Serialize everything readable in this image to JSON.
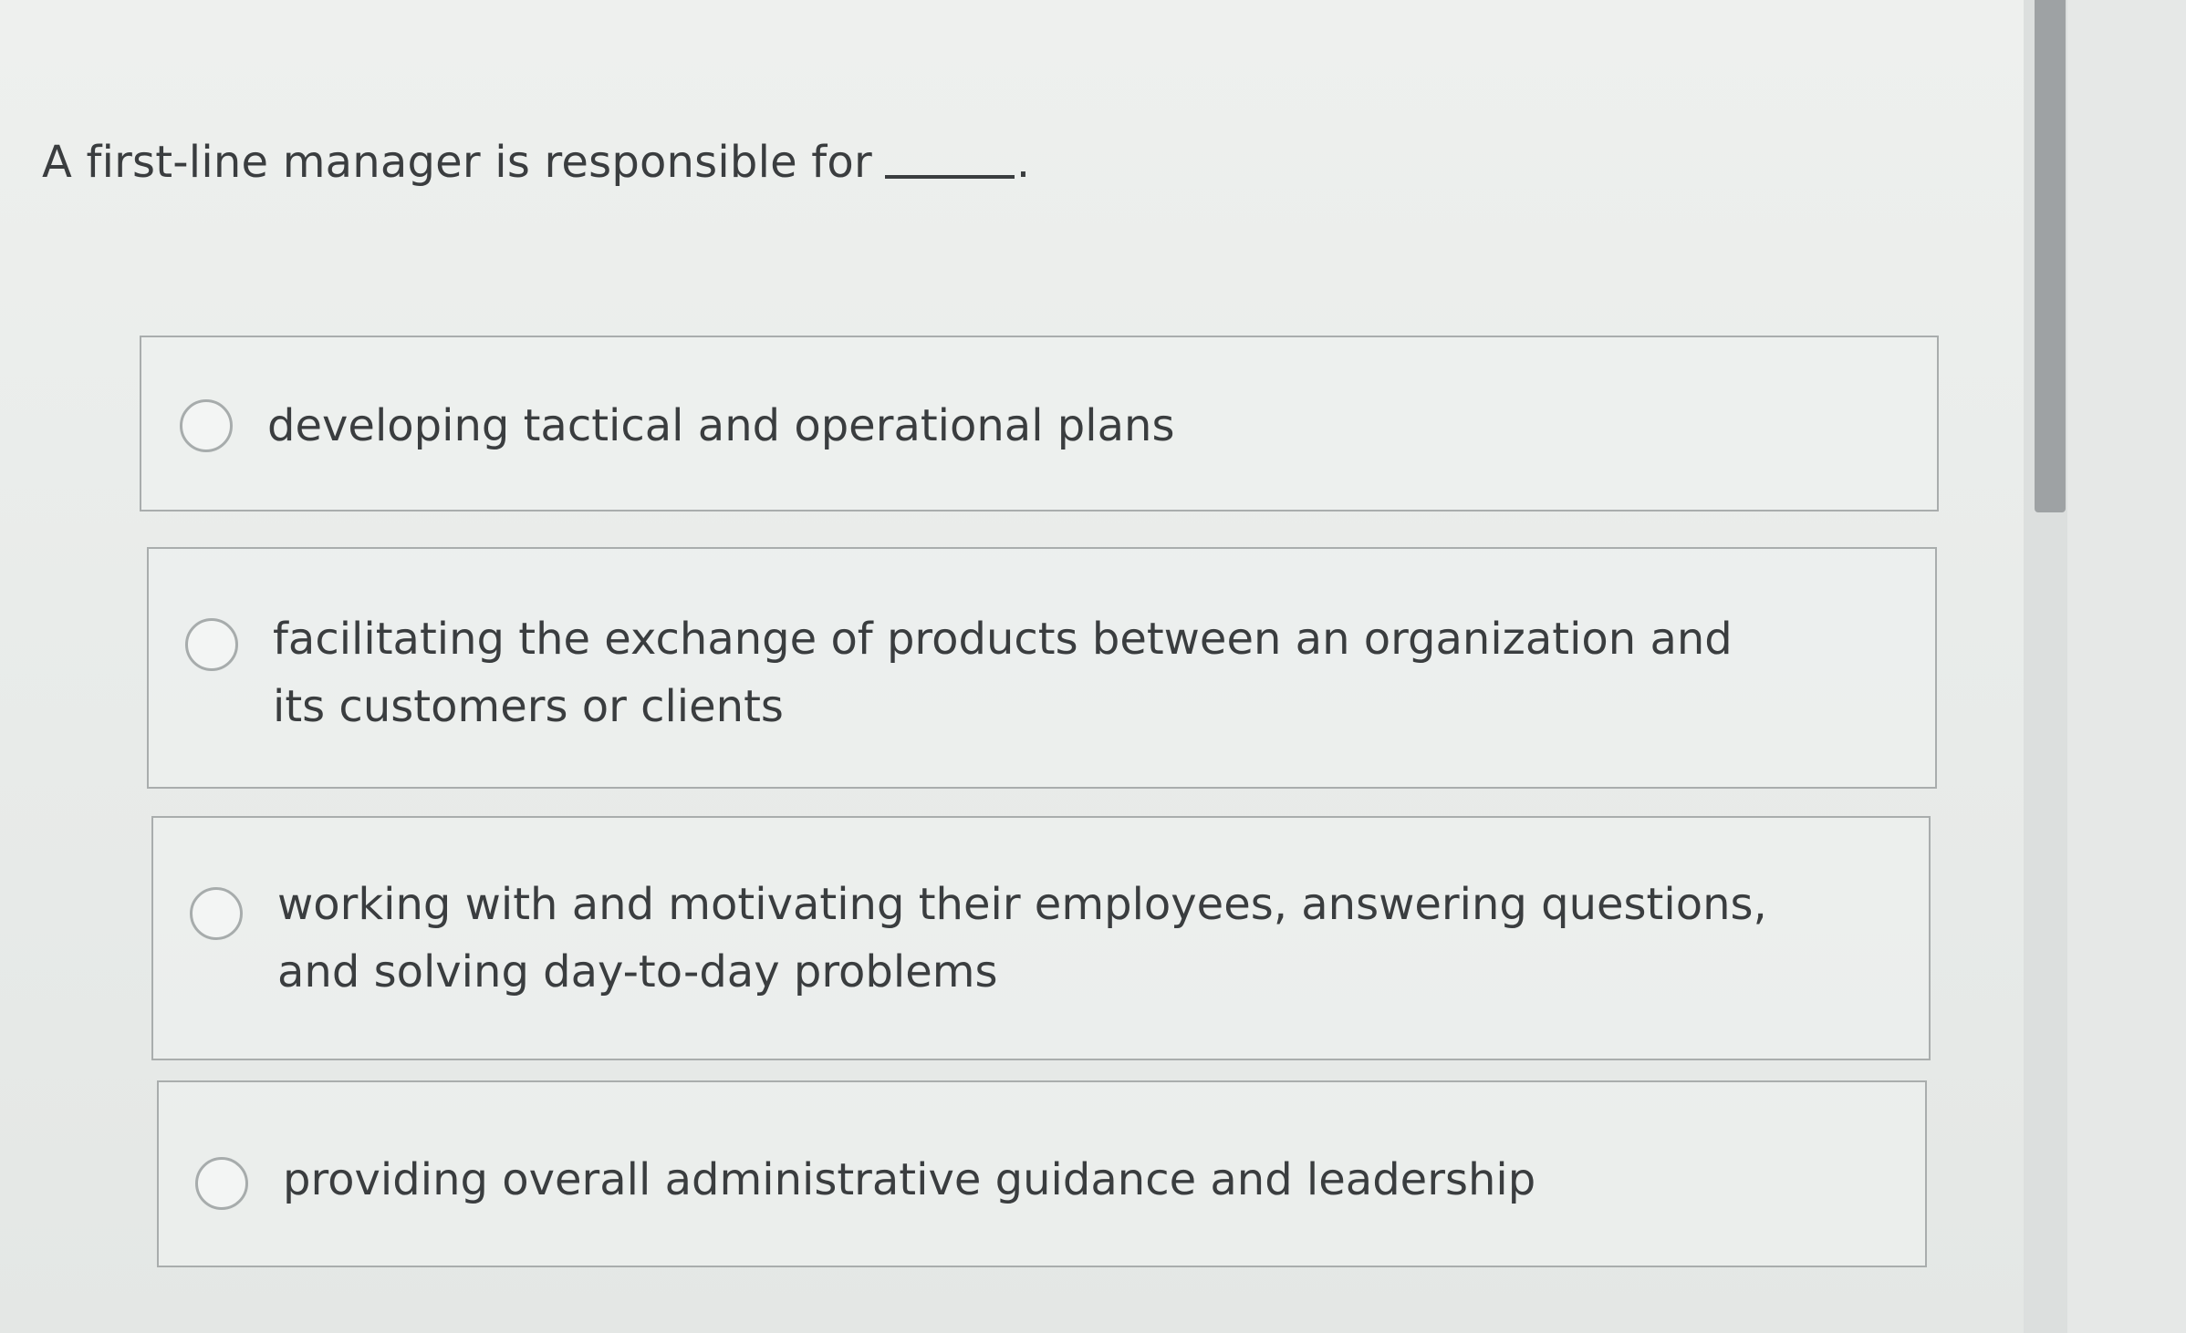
{
  "question": {
    "text": "A first-line manager is responsible for",
    "blank": "______",
    "end": "."
  },
  "options": [
    {
      "label": "developing tactical and operational plans",
      "selected": false
    },
    {
      "label": "facilitating the exchange of products between an organization and its customers or clients",
      "selected": false
    },
    {
      "label": "working with and motivating their employees, answering questions, and solving day-to-day problems",
      "selected": false
    },
    {
      "label": "providing overall administrative guidance and leadership",
      "selected": false
    }
  ],
  "colors": {
    "text": "#3a3d3f",
    "border": "#a9adad",
    "scrollbar_thumb": "#9ea2a4"
  }
}
